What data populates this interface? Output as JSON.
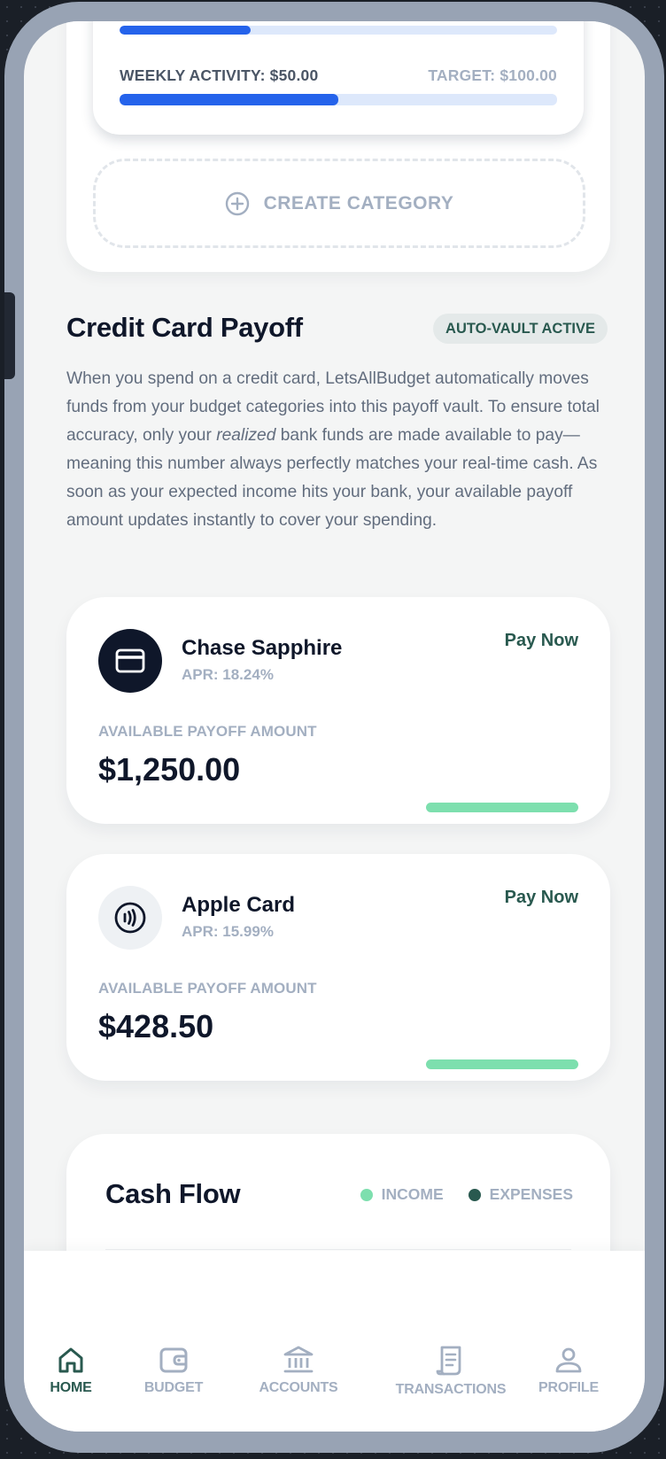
{
  "budget_card": {
    "weekly_activity": "WEEKLY ACTIVITY: $50.00",
    "target": "TARGET: $100.00",
    "weekly_progress": 0.5,
    "previous_progress": 0.3,
    "create_category_label": "CREATE CATEGORY"
  },
  "payoff": {
    "title": "Credit Card Payoff",
    "badge": "AUTO-VAULT ACTIVE",
    "description_part1": "When you spend on a credit card, LetsAllBudget automatically moves funds from your budget categories into this payoff vault. To ensure total accuracy, only your ",
    "description_emphasis": "realized",
    "description_part2": " bank funds are made available to pay—meaning this number always perfectly matches your real-time cash. As soon as your expected income hits your bank, your available payoff amount updates instantly to cover your spending.",
    "cards": [
      {
        "name": "Chase Sapphire",
        "apr": "APR: 18.24%",
        "pay_label": "Pay Now",
        "available_label": "AVAILABLE PAYOFF AMOUNT",
        "amount": "$1,250.00",
        "icon": "credit-card-icon"
      },
      {
        "name": "Apple Card",
        "apr": "APR: 15.99%",
        "pay_label": "Pay Now",
        "available_label": "AVAILABLE PAYOFF AMOUNT",
        "amount": "$428.50",
        "icon": "contactless-icon"
      }
    ]
  },
  "cash_flow": {
    "title": "Cash Flow",
    "legend": [
      {
        "label": "INCOME",
        "color": "#7ddfae"
      },
      {
        "label": "EXPENSES",
        "color": "#29594f"
      }
    ]
  },
  "nav": {
    "items": [
      {
        "label": "HOME",
        "icon": "home-icon",
        "active": true
      },
      {
        "label": "BUDGET",
        "icon": "wallet-icon",
        "active": false
      },
      {
        "label": "ACCOUNTS",
        "icon": "bank-icon",
        "active": false
      },
      {
        "label": "TRANSACTIONS",
        "icon": "receipt-icon",
        "active": false
      },
      {
        "label": "PROFILE",
        "icon": "user-icon",
        "active": false
      }
    ]
  },
  "colors": {
    "primary_blue": "#2563eb",
    "accent_green": "#7ddfae",
    "dark_teal": "#29594f",
    "navy": "#0f172a",
    "muted": "#a3afc1"
  }
}
